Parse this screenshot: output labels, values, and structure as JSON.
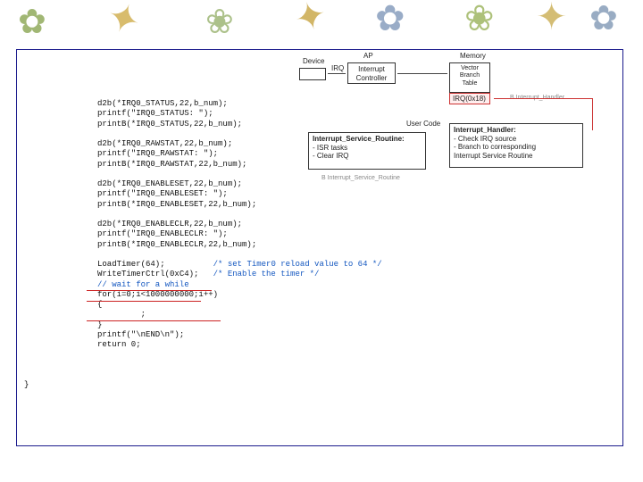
{
  "diagram": {
    "device": "Device",
    "irq": "IRQ",
    "ap": "AP",
    "controller": "Interrupt\nController",
    "memory": "Memory",
    "vbt": "Vector\nBranch\nTable",
    "irqvec": "IRQ(0x18)",
    "bih": "B Interrupt_Handler",
    "ih_title": "Interrupt_Handler:",
    "ih_l1": "- Check IRQ source",
    "ih_l2": "- Branch to corresponding",
    "ih_l3": "  Interrupt Service Routine",
    "usercode": "User Code",
    "isr_title": "Interrupt_Service_Routine:",
    "isr_l1": "- ISR tasks",
    "isr_l2": "- Clear IRQ",
    "bisr": "B Interrupt_Service_Routine"
  },
  "code": {
    "b1l1": "d2b(*IRQ0_STATUS,22,b_num);",
    "b1l2": "printf(\"IRQ0_STATUS: \");",
    "b1l3": "printB(*IRQ0_STATUS,22,b_num);",
    "b2l1": "d2b(*IRQ0_RAWSTAT,22,b_num);",
    "b2l2": "printf(\"IRQ0_RAWSTAT: \");",
    "b2l3": "printB(*IRQ0_RAWSTAT,22,b_num);",
    "b3l1": "d2b(*IRQ0_ENABLESET,22,b_num);",
    "b3l2": "printf(\"IRQ0_ENABLESET: \");",
    "b3l3": "printB(*IRQ0_ENABLESET,22,b_num);",
    "b4l1": "d2b(*IRQ0_ENABLECLR,22,b_num);",
    "b4l2": "printf(\"IRQ0_ENABLECLR: \");",
    "b4l3": "printB(*IRQ0_ENABLECLR,22,b_num);",
    "lt": "LoadTimer(64);",
    "ltc": "/* set Timer0 reload value to 64 */",
    "wt": "WriteTimerCtrl(0xC4);",
    "wtc": "/* Enable the timer */",
    "wait": "// wait for a while",
    "for": "for(i=0;i<1000000000;i++)",
    "ob": "{",
    "sc": "         ;",
    "cb": "}",
    "pend": "printf(\"\\nEND\\n\");",
    "ret": "return 0;",
    "close": "}"
  }
}
